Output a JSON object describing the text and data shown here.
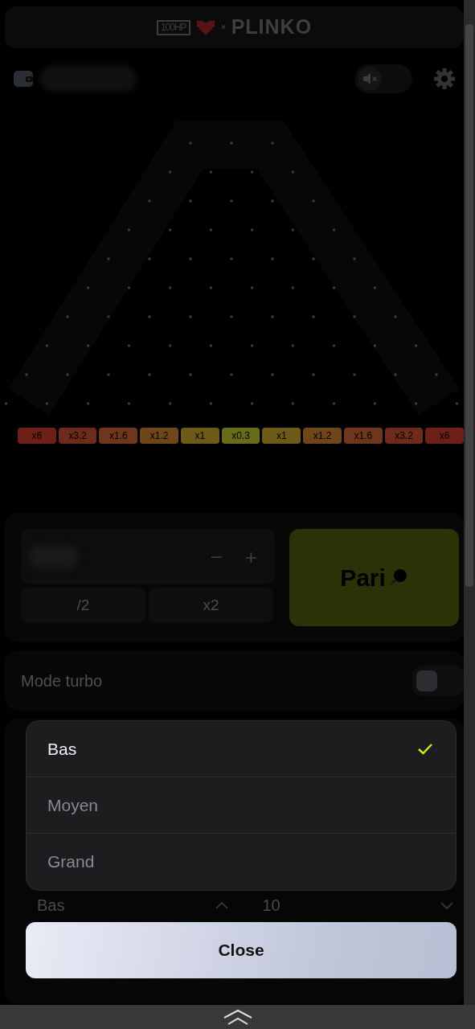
{
  "header": {
    "logo_badge": "100HP",
    "separator": "×",
    "title": "PLINKO"
  },
  "toolbar": {
    "sound_muted": true
  },
  "multipliers": [
    {
      "label": "x6",
      "color": "#6e2018"
    },
    {
      "label": "x3.2",
      "color": "#6e2a1a"
    },
    {
      "label": "x1.6",
      "color": "#6e361a"
    },
    {
      "label": "x1.2",
      "color": "#6e461a"
    },
    {
      "label": "x1",
      "color": "#6e5a18"
    },
    {
      "label": "x0.3",
      "color": "#686c18"
    },
    {
      "label": "x1",
      "color": "#6e5a18"
    },
    {
      "label": "x1.2",
      "color": "#6e461a"
    },
    {
      "label": "x1.6",
      "color": "#6e361a"
    },
    {
      "label": "x3.2",
      "color": "#6e2a1a"
    },
    {
      "label": "x6",
      "color": "#6e2018"
    }
  ],
  "bet": {
    "minus": "−",
    "plus": "+",
    "half": "/2",
    "double": "x2",
    "action": "Pari"
  },
  "turbo": {
    "label": "Mode turbo",
    "on": false
  },
  "settings": {
    "risk": "Bas",
    "rows": "10"
  },
  "risk_menu": {
    "options": [
      {
        "label": "Bas",
        "selected": true
      },
      {
        "label": "Moyen",
        "selected": false
      },
      {
        "label": "Grand",
        "selected": false
      }
    ],
    "close": "Close"
  }
}
